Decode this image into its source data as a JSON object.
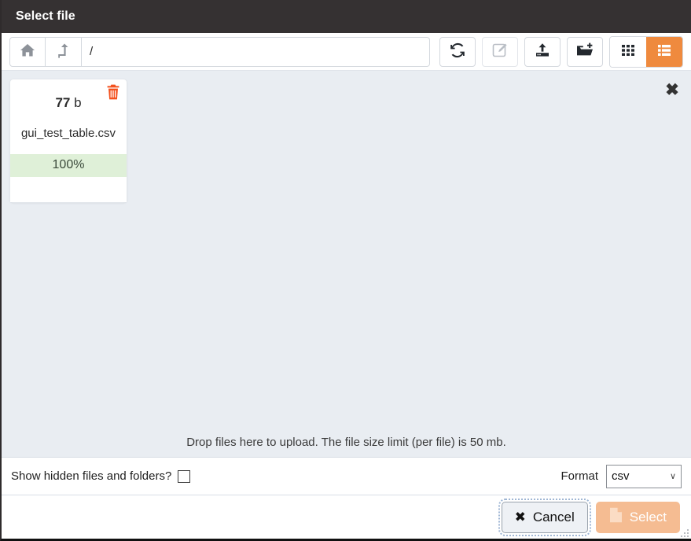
{
  "window": {
    "title": "Select file"
  },
  "toolbar": {
    "home_icon": "home-icon",
    "up_icon": "level-up-icon",
    "path_value": "/",
    "path_placeholder": "",
    "buttons": [
      {
        "name": "refresh-button",
        "icon": "refresh-icon",
        "disabled": false
      },
      {
        "name": "rename-button",
        "icon": "edit-pencil-icon",
        "disabled": true
      },
      {
        "name": "upload-button",
        "icon": "upload-icon",
        "disabled": false
      },
      {
        "name": "new-folder-button",
        "icon": "folder-plus-icon",
        "disabled": false
      }
    ],
    "view_grid_icon": "grid-view-icon",
    "view_list_icon": "list-view-icon",
    "active_view": "list",
    "active_color": "#ef8a3e"
  },
  "filearea": {
    "close_label": "✖",
    "drop_hint": "Drop files here to upload. The file size limit (per file) is 50 mb.",
    "background": "#e9edf2",
    "files": [
      {
        "size_number": "77",
        "size_unit": "b",
        "name": "gui_test_table.csv",
        "progress_label": "100%",
        "progress_percent": 100,
        "progress_color": "#dff0d8",
        "delete_icon": "trash-icon",
        "delete_color": "#f4511e"
      }
    ]
  },
  "options": {
    "hidden_label": "Show hidden files and folders?",
    "hidden_checked": false,
    "format_label": "Format",
    "format_value": "csv",
    "format_chevron": "∨"
  },
  "footer": {
    "cancel_label": "Cancel",
    "cancel_icon": "x-icon",
    "cancel_icon_glyph": "✖",
    "select_label": "Select",
    "select_icon": "file-icon",
    "select_disabled": true,
    "resize_grip": "resize-grip"
  }
}
